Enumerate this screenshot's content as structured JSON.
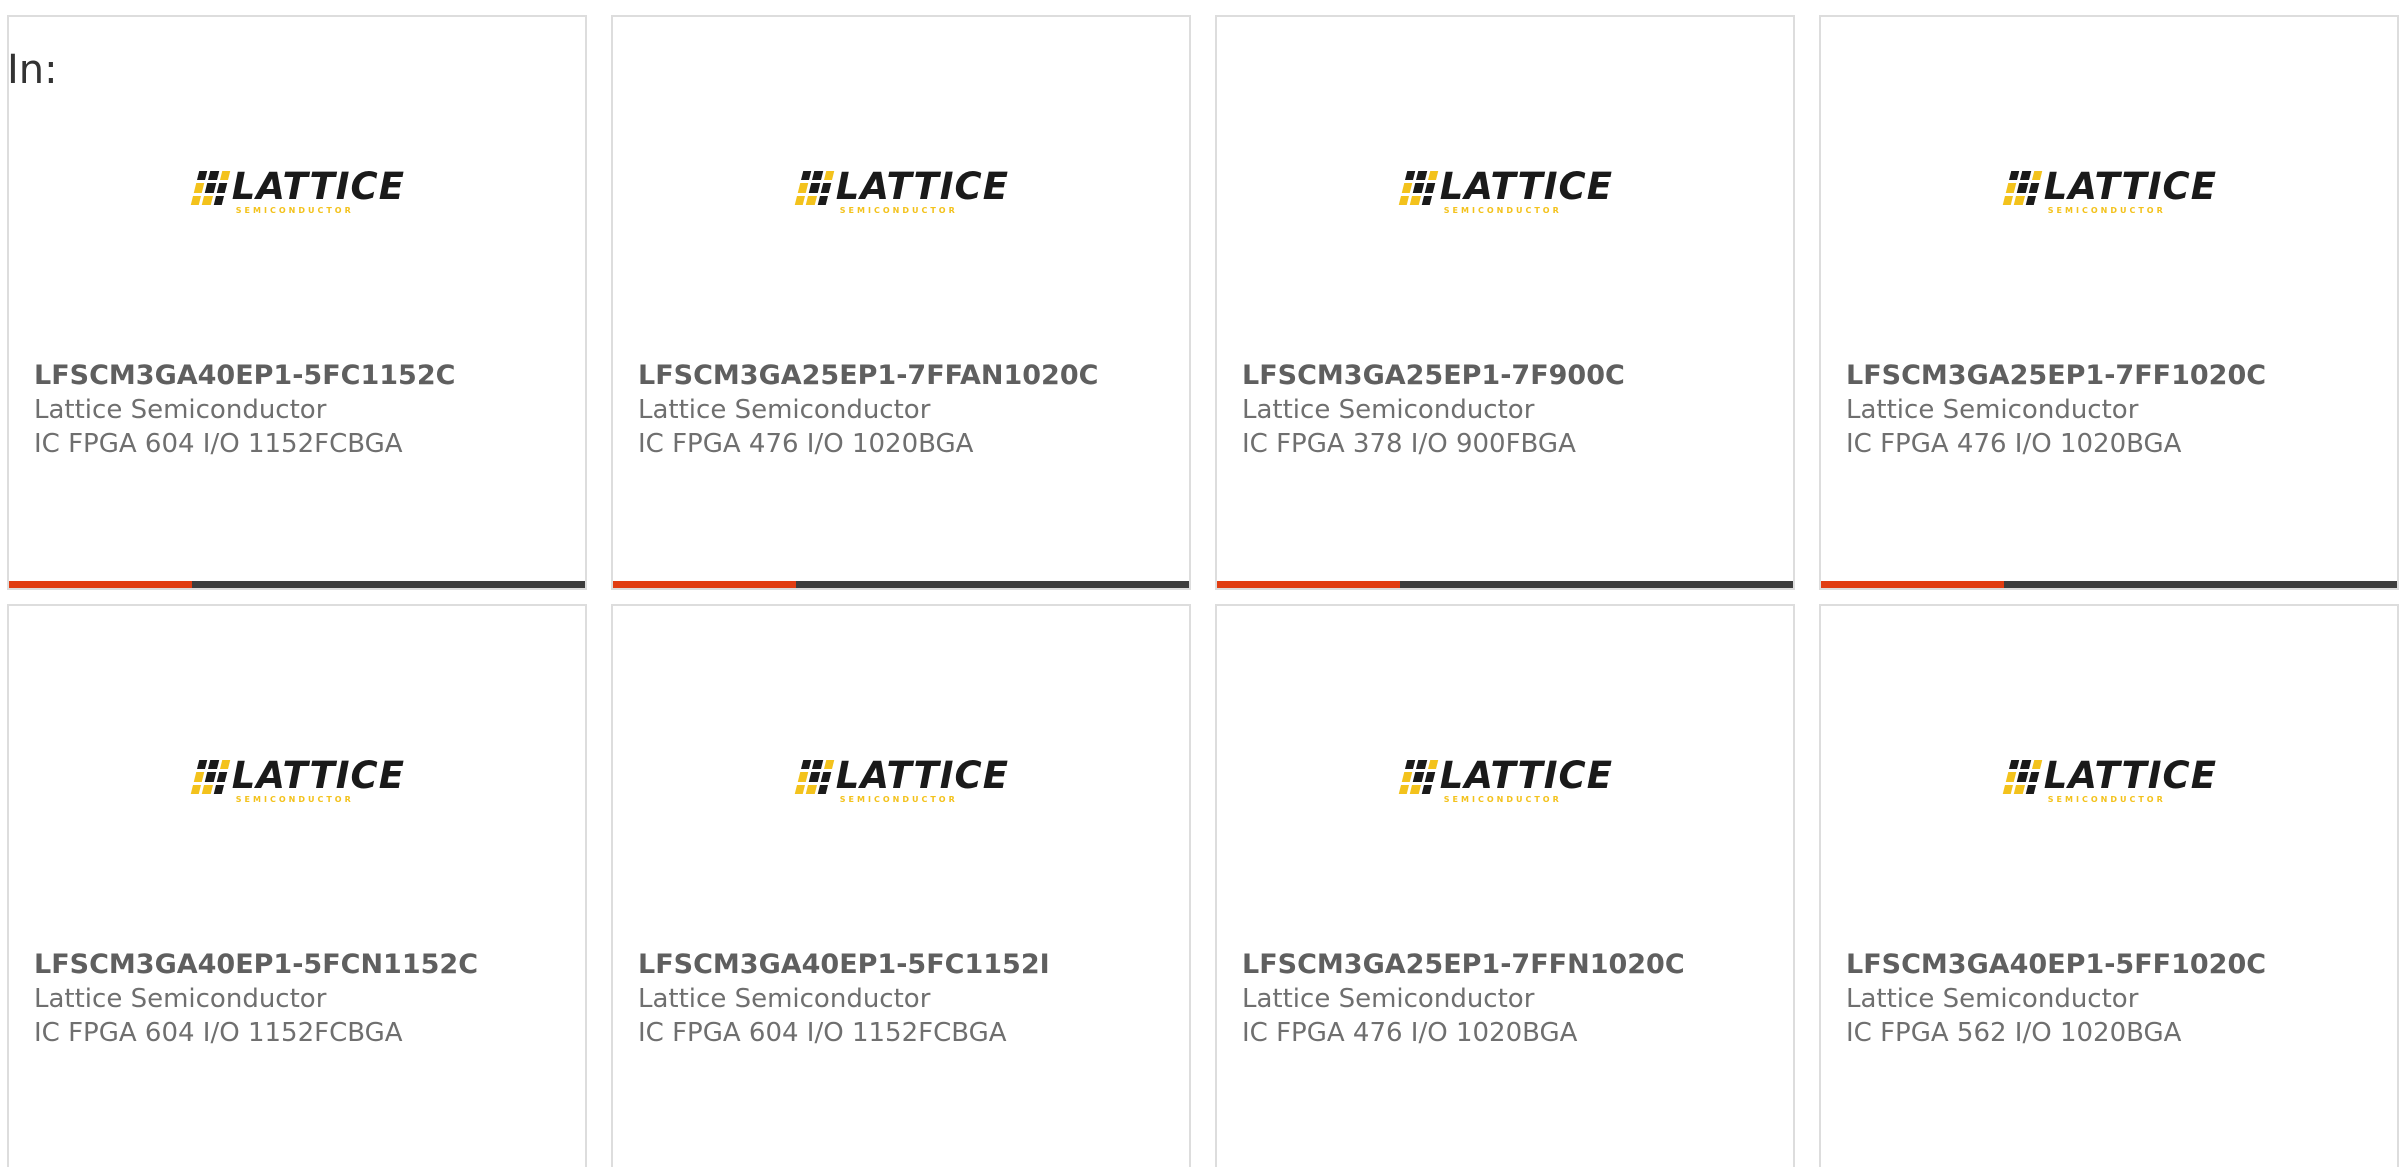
{
  "filter": {
    "in_label": "In:"
  },
  "brand": {
    "logo_word": "LATTICE",
    "logo_sub": "SEMICONDUCTOR",
    "accent_color": "#e13d12",
    "bar_color": "#3d3d3d",
    "logo_yellow": "#f3c21c"
  },
  "products": [
    {
      "part": "LFSCM3GA40EP1-5FC1152C",
      "maker": "Lattice Semiconductor",
      "desc": "IC FPGA 604 I/O 1152FCBGA"
    },
    {
      "part": "LFSCM3GA25EP1-7FFAN1020C",
      "maker": "Lattice Semiconductor",
      "desc": "IC FPGA 476 I/O 1020BGA"
    },
    {
      "part": "LFSCM3GA25EP1-7F900C",
      "maker": "Lattice Semiconductor",
      "desc": "IC FPGA 378 I/O 900FBGA"
    },
    {
      "part": "LFSCM3GA25EP1-7FF1020C",
      "maker": "Lattice Semiconductor",
      "desc": "IC FPGA 476 I/O 1020BGA"
    },
    {
      "part": "LFSCM3GA40EP1-5FCN1152C",
      "maker": "Lattice Semiconductor",
      "desc": "IC FPGA 604 I/O 1152FCBGA"
    },
    {
      "part": "LFSCM3GA40EP1-5FC1152I",
      "maker": "Lattice Semiconductor",
      "desc": "IC FPGA 604 I/O 1152FCBGA"
    },
    {
      "part": "LFSCM3GA25EP1-7FFN1020C",
      "maker": "Lattice Semiconductor",
      "desc": "IC FPGA 476 I/O 1020BGA"
    },
    {
      "part": "LFSCM3GA40EP1-5FF1020C",
      "maker": "Lattice Semiconductor",
      "desc": "IC FPGA 562 I/O 1020BGA"
    }
  ]
}
